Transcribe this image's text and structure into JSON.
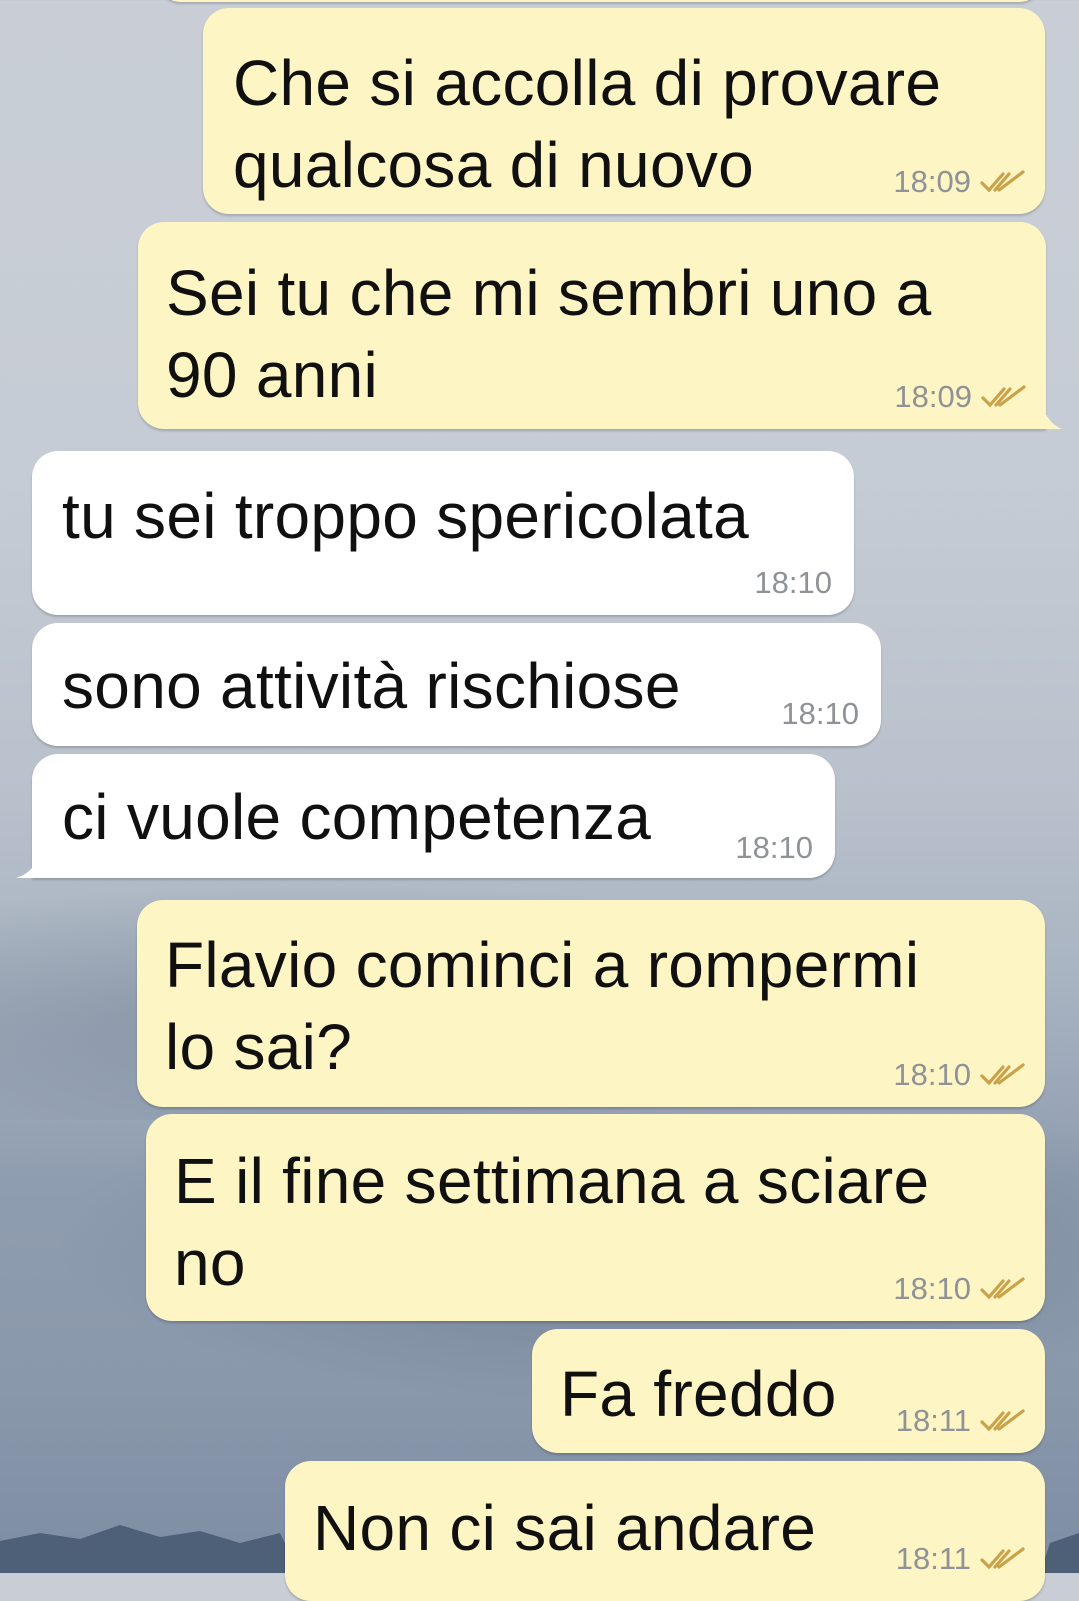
{
  "messages": [
    {
      "text": "Che si accolla di provare\nqualcosa di nuovo",
      "time": "18:09"
    },
    {
      "text": "Sei tu che mi sembri uno a\n90 anni",
      "time": "18:09"
    },
    {
      "text": "tu sei troppo spericolata",
      "time": "18:10"
    },
    {
      "text": "sono attività rischiose",
      "time": "18:10"
    },
    {
      "text": "ci vuole competenza",
      "time": "18:10"
    },
    {
      "text": "Flavio cominci a rompermi\nlo sai?",
      "time": "18:10"
    },
    {
      "text": "E il fine settimana a sciare\nno",
      "time": "18:10"
    },
    {
      "text": "Fa freddo",
      "time": "18:11"
    },
    {
      "text": "Non ci sai andare",
      "time": "18:11"
    }
  ],
  "colors": {
    "outgoing_bubble": "#fdf5c3",
    "incoming_bubble": "#ffffff",
    "read_ticks": "#c9a24a",
    "timestamp": "#8f9296"
  },
  "icons": {
    "read_receipt": "double-check-icon"
  }
}
